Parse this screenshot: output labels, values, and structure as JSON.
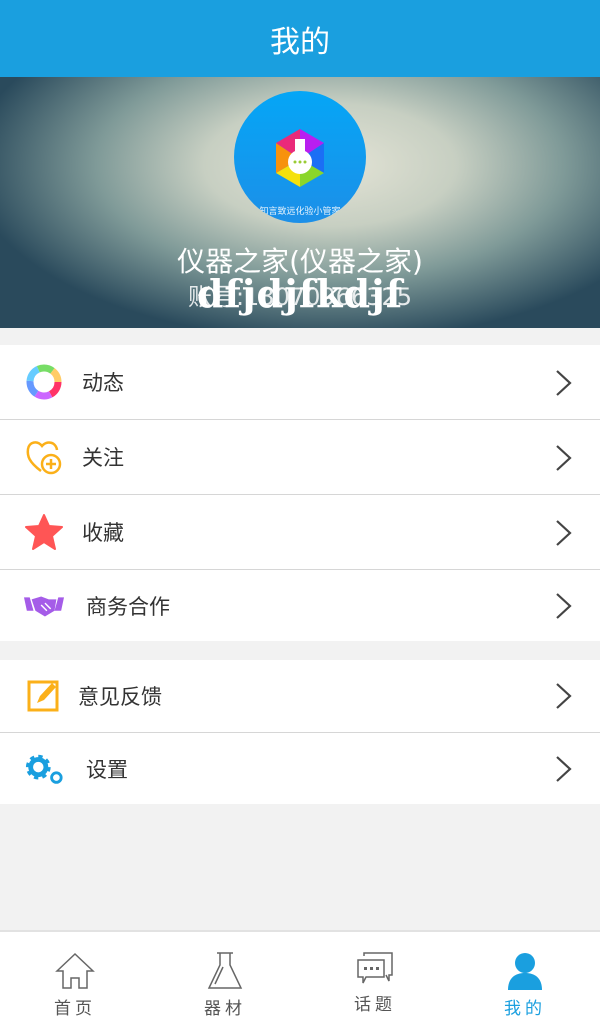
{
  "header": {
    "title": "我的"
  },
  "profile": {
    "name": "仪器之家(仪器之家)",
    "account": "账号:13070966325",
    "signature": "dfjdjfkdjf",
    "avatar_caption": "知言致远化验小管家"
  },
  "menu_group_1": [
    {
      "label": "动态",
      "icon": "ring-icon"
    },
    {
      "label": "关注",
      "icon": "heart-plus-icon"
    },
    {
      "label": "收藏",
      "icon": "star-icon"
    },
    {
      "label": "商务合作",
      "icon": "handshake-icon"
    }
  ],
  "menu_group_2": [
    {
      "label": "意见反馈",
      "icon": "edit-icon"
    },
    {
      "label": "设置",
      "icon": "gear-icon"
    }
  ],
  "nav": [
    {
      "label": "首页",
      "icon": "home-icon"
    },
    {
      "label": "器材",
      "icon": "flask-icon"
    },
    {
      "label": "话题",
      "icon": "chat-icon"
    },
    {
      "label": "我的",
      "icon": "user-icon",
      "active": true
    }
  ],
  "colors": {
    "accent": "#1a9fdf"
  }
}
